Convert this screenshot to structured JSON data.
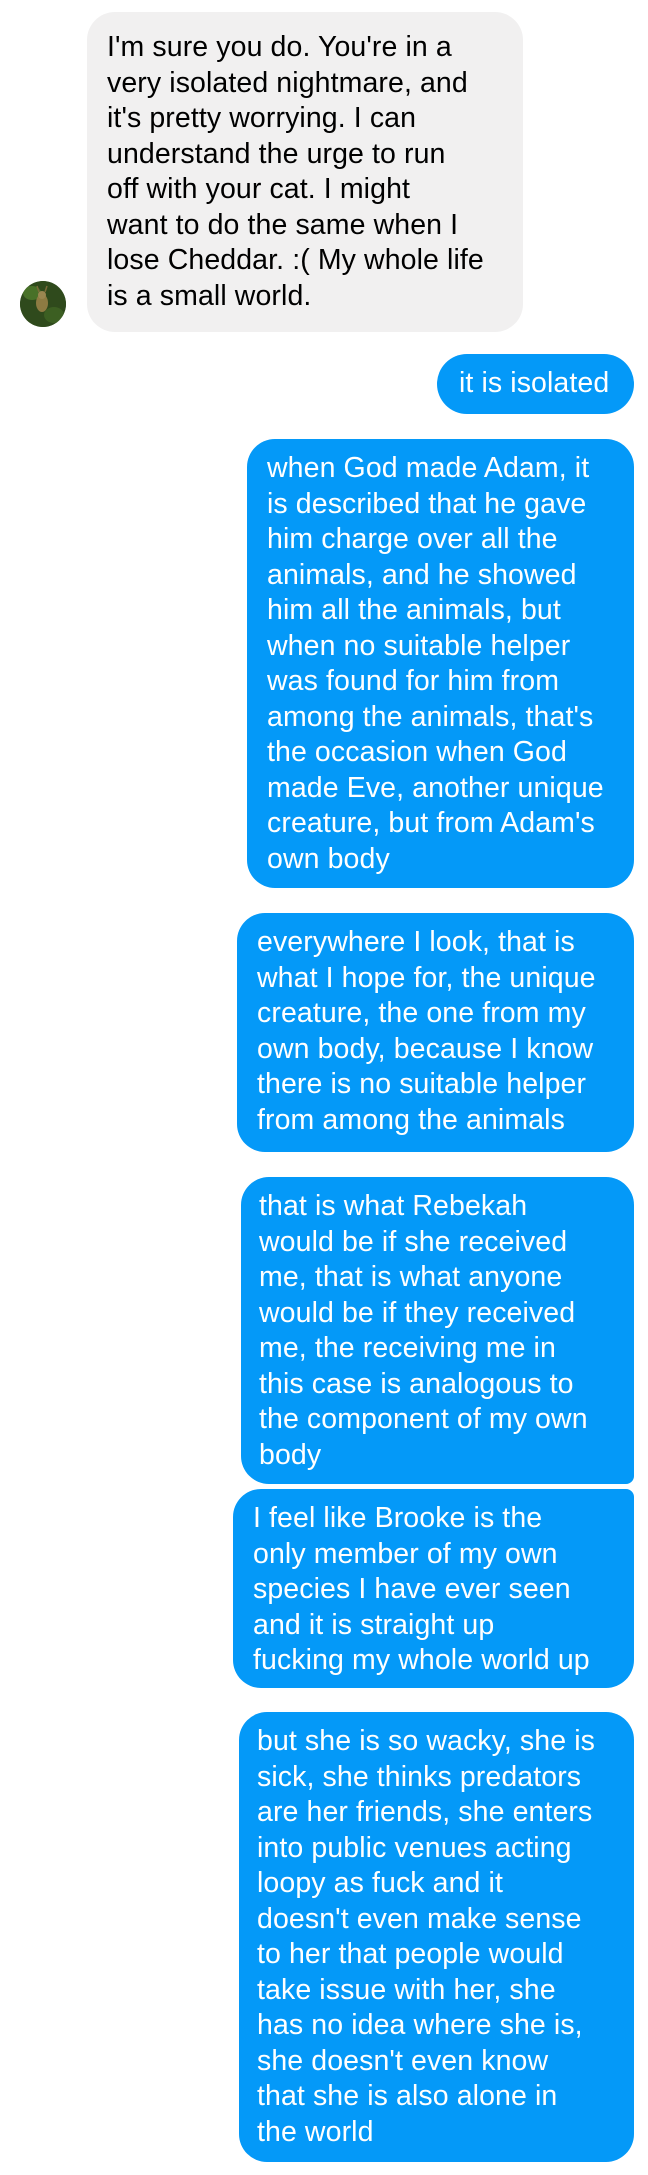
{
  "conversation": {
    "contact_avatar": "green-nature-avatar",
    "messages": [
      {
        "direction": "incoming",
        "text": "I'm sure you do. You're in a\nvery isolated nightmare, and\nit's pretty worrying. I can\nunderstand the urge to run\noff with your cat. I might\nwant to do the same when I\nlose Cheddar. :( My whole life\nis a small world."
      },
      {
        "direction": "outgoing",
        "text": "it is isolated"
      },
      {
        "direction": "outgoing",
        "text": "when God made Adam, it\nis described that he gave\nhim charge over all the\nanimals, and he showed\nhim all the animals, but\nwhen no suitable helper\nwas found for him from\namong the animals, that's\nthe occasion when God\nmade Eve, another unique\ncreature, but from Adam's\nown body"
      },
      {
        "direction": "outgoing",
        "text": "everywhere I look, that is\nwhat I hope for, the unique\ncreature, the one from my\nown body, because I know\nthere is no suitable helper\nfrom among the animals"
      },
      {
        "direction": "outgoing",
        "text": "that is what Rebekah\nwould be if she received\nme, that is what anyone\nwould be if they received\nme, the receiving me in\nthis case is analogous to\nthe component of my own\nbody"
      },
      {
        "direction": "outgoing",
        "text": "I feel like Brooke is the\nonly member of my own\nspecies I have ever seen\nand it is straight up\nfucking my whole world up"
      },
      {
        "direction": "outgoing",
        "text": "but she is so wacky, she is\nsick, she thinks predators\nare her friends, she enters\ninto public venues acting\nloopy as fuck and it\ndoesn't even make sense\nto her that people would\ntake issue with her, she\nhas no idea where she is,\nshe doesn't even know\nthat she is also alone in\nthe world"
      }
    ]
  },
  "colors": {
    "incoming_bubble": "#f1f0f0",
    "outgoing_bubble": "#0499f8",
    "incoming_text": "#000000",
    "outgoing_text": "#ffffff"
  }
}
